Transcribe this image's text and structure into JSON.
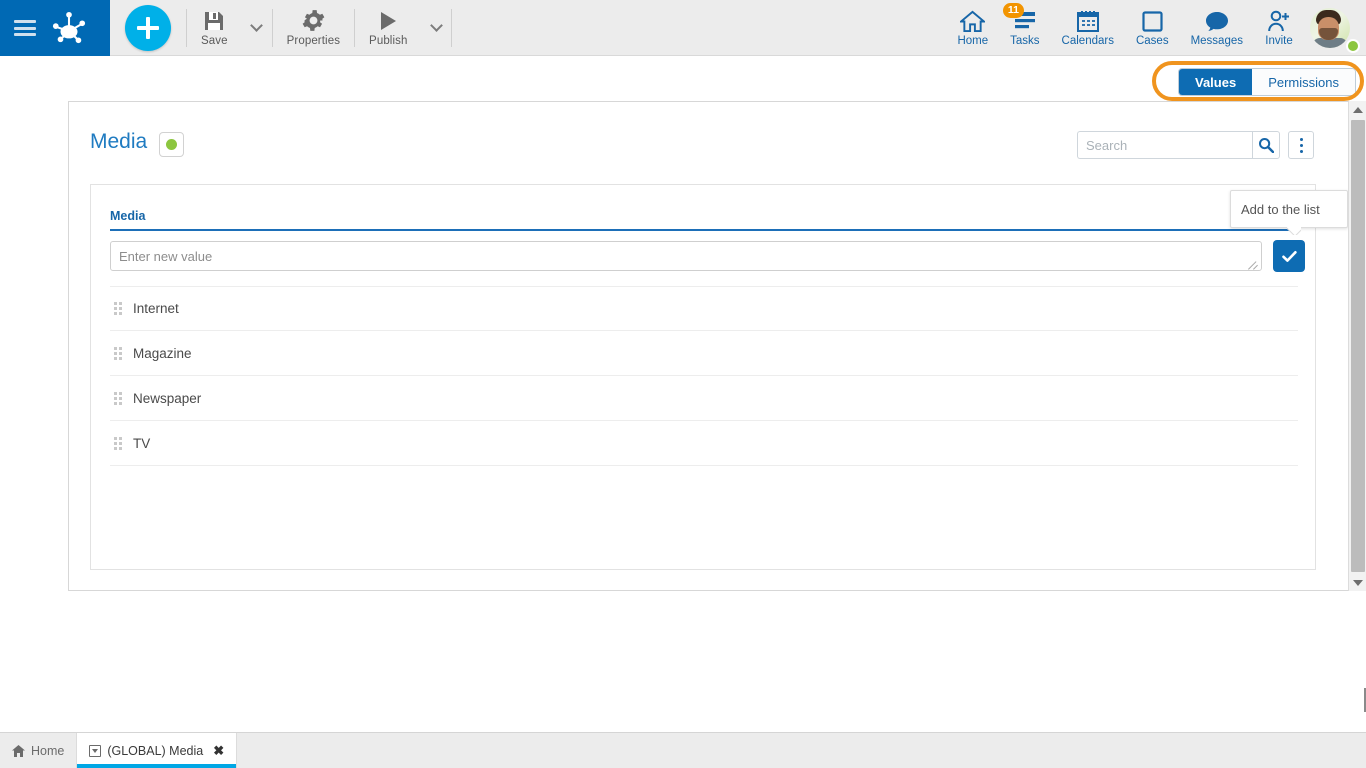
{
  "topbar": {
    "menu_icon": "hamburger-icon",
    "logo_icon": "frog-logo-icon",
    "add_button_label": "+",
    "tools": [
      {
        "label": "Save",
        "icon": "floppy-disk-icon",
        "has_caret": true
      },
      {
        "label": "Properties",
        "icon": "gear-icon",
        "has_caret": false
      },
      {
        "label": "Publish",
        "icon": "play-triangle-icon",
        "has_caret": true
      }
    ],
    "nav": [
      {
        "label": "Home",
        "icon": "house-icon",
        "badge": ""
      },
      {
        "label": "Tasks",
        "icon": "task-list-icon",
        "badge": "11"
      },
      {
        "label": "Calendars",
        "icon": "calendar-icon",
        "badge": ""
      },
      {
        "label": "Cases",
        "icon": "square-icon",
        "badge": ""
      },
      {
        "label": "Messages",
        "icon": "speech-bubble-icon",
        "badge": ""
      },
      {
        "label": "Invite",
        "icon": "person-plus-icon",
        "badge": ""
      }
    ],
    "avatar": {
      "name": "user-avatar",
      "presence": "online"
    }
  },
  "tabs": {
    "items": [
      {
        "label": "Values",
        "active": true
      },
      {
        "label": "Permissions",
        "active": false
      }
    ],
    "highlight_color": "#f0941e"
  },
  "card": {
    "title": "Media",
    "status_dot_color": "#8cc63f",
    "search": {
      "value": "",
      "placeholder": "Search"
    },
    "search_icon": "magnifier-icon",
    "kebab_icon": "vertical-dots-icon"
  },
  "panel": {
    "label": "Media",
    "new_value": {
      "value": "",
      "placeholder": "Enter new value"
    },
    "add_button_icon": "check-icon",
    "tooltip": "Add to the list",
    "rows": [
      {
        "label": "Internet"
      },
      {
        "label": "Magazine"
      },
      {
        "label": "Newspaper"
      },
      {
        "label": "TV"
      }
    ]
  },
  "taskbar": {
    "items": [
      {
        "label": "Home",
        "icon": "house-icon",
        "active": false,
        "closable": false
      },
      {
        "label": "(GLOBAL) Media",
        "icon": "window-icon",
        "active": true,
        "closable": true,
        "close_glyph": "✖"
      }
    ]
  },
  "colors": {
    "brand_blue": "#0069b4",
    "accent_cyan": "#00b0e8",
    "tab_active": "#0e6cb3",
    "highlight_orange": "#f0941e",
    "status_green": "#8cc63f",
    "badge_orange": "#f29400"
  }
}
